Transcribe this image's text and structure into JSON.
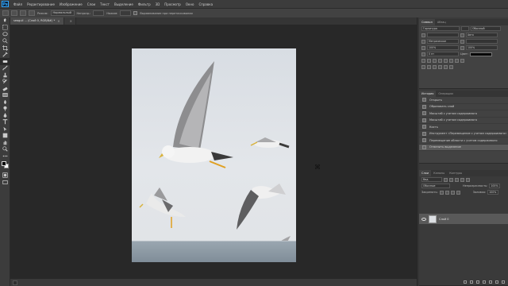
{
  "app": {
    "logo": "Ps"
  },
  "menu": [
    "Файл",
    "Редактирование",
    "Изображение",
    "Слои",
    "Текст",
    "Выделение",
    "Фильтр",
    "3D",
    "Просмотр",
    "Окно",
    "Справка"
  ],
  "options": {
    "mode_label": "Режим:",
    "mode_value": "Нормальный",
    "opacity_label": "Непрозр.:",
    "opacity_value": "",
    "flow_label": "Нажим:",
    "flow_value": "",
    "align_label": "Выравнивание при перетаскивании"
  },
  "tabs": [
    {
      "label": "seagull ... (Слой 0, RGB/8#) *",
      "active": true
    },
    {
      "label": "",
      "active": false
    }
  ],
  "status": {
    "zoom": "",
    "doc": ""
  },
  "colors": {
    "foreground": "#000000",
    "background": "#ffffff",
    "canvas_bg": "#282828"
  },
  "panels": {
    "character": {
      "tabs": [
        "Символ",
        "Абзац"
      ],
      "rows": [
        [
          "Гарнитура",
          "",
          "Обычный"
        ],
        [
          "",
          "",
          "Авто"
        ],
        [
          "",
          "Метрическое",
          ""
        ],
        [
          "100%",
          "",
          "100%"
        ],
        [
          "0 пт",
          "Цвет:",
          ""
        ]
      ]
    },
    "history": {
      "tabs": [
        "История",
        "Операции"
      ],
      "items": [
        {
          "label": "Открыть",
          "selected": false
        },
        {
          "label": "Образовать слой",
          "selected": false
        },
        {
          "label": "Масштаб с учетом содержимого",
          "selected": false
        },
        {
          "label": "Масштаб с учетом содержимого",
          "selected": false
        },
        {
          "label": "Кисть",
          "selected": false
        },
        {
          "label": "Инструмент «Перемещение с учетом содержимого»",
          "selected": false
        },
        {
          "label": "Перемещение области с учетом содержимого",
          "selected": false
        },
        {
          "label": "Отменить выделение",
          "selected": true
        }
      ]
    },
    "layers": {
      "tabs": [
        "Слои",
        "Каналы",
        "Контуры"
      ],
      "kind_label": "Вид",
      "blend_mode": "Обычные",
      "opacity_label": "Непрозрачность:",
      "opacity_value": "100%",
      "lock_label": "Закрепить:",
      "fill_label": "Заливка:",
      "fill_value": "100%",
      "layer_name": "Слой 0"
    }
  }
}
